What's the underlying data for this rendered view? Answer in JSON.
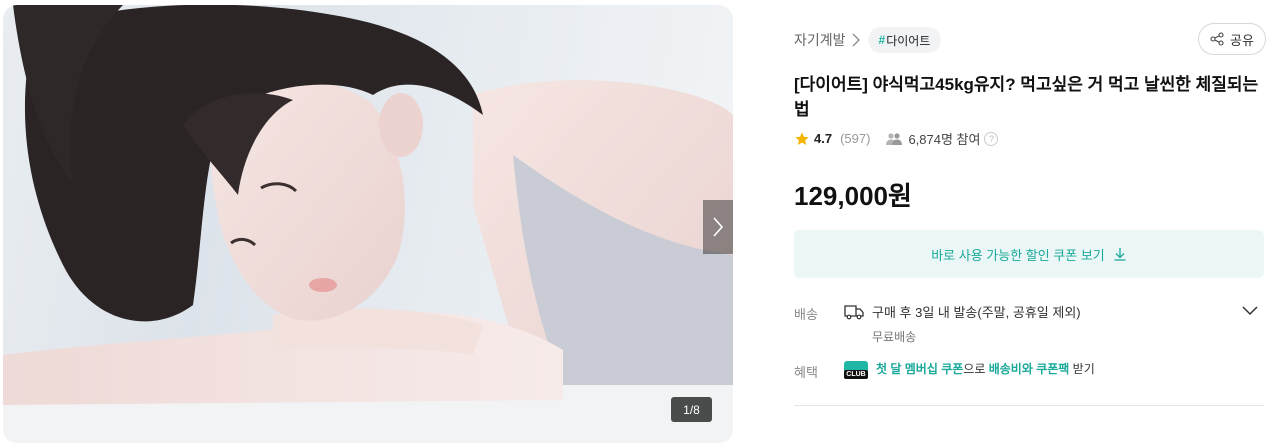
{
  "gallery": {
    "page_counter": "1/8",
    "next_icon": "chevron-right-icon"
  },
  "breadcrumb": {
    "category": "자기계발",
    "tag_hash": "#",
    "tag_label": "다이어트"
  },
  "share": {
    "label": "공유",
    "icon": "share-icon"
  },
  "product": {
    "title": "[다이어트] 야식먹고45kg유지? 먹고싶은 거 먹고 날씬한 체질되는 법",
    "rating": "4.7",
    "review_count": "(597)",
    "participants": "6,874명 참여",
    "help_glyph": "?",
    "price": "129,000원"
  },
  "coupon": {
    "label": "바로 사용 가능한 할인 쿠폰 보기",
    "icon": "download-icon"
  },
  "shipping": {
    "label": "배송",
    "text": "구매 후 3일 내 발송(주말, 공휴일 제외)",
    "sub": "무료배송",
    "icon": "truck-icon"
  },
  "benefit": {
    "label": "혜택",
    "badge": "CLUB",
    "part1": "첫 달 멤버십 쿠폰",
    "part2": "으로 ",
    "part3": "배송비와 쿠폰팩",
    "part4": " 받기"
  },
  "colors": {
    "accent": "#1fb6a6",
    "coupon_bg": "#eaf7f6",
    "star": "#f5b400"
  }
}
